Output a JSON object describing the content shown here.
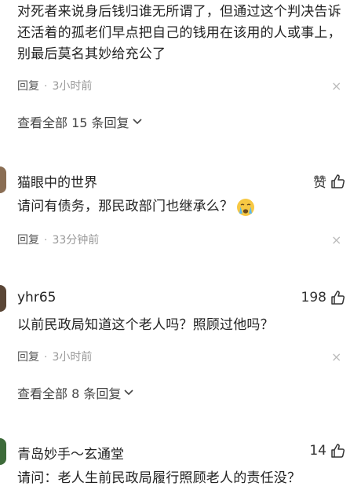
{
  "comments": [
    {
      "text": "对死者来说身后钱归谁无所谓了，但通过这个判决告诉还活着的孤老们早点把自己的钱用在该用的人或事上，别最后莫名其妙给充公了",
      "reply_label": "回复",
      "separator": "·",
      "time": "3小时前",
      "close": "×",
      "view_replies": "查看全部 15 条回复"
    },
    {
      "username": "猫眼中的世界",
      "like_label": "赞",
      "text": "请问有债务，那民政部门也继承么？",
      "emoji": "crying-face-emoji",
      "reply_label": "回复",
      "separator": "·",
      "time": "33分钟前",
      "close": "×"
    },
    {
      "username": "yhr65",
      "like_count": "198",
      "text": "以前民政局知道这个老人吗？照顾过他吗？",
      "reply_label": "回复",
      "separator": "·",
      "time": "3小时前",
      "close": "×",
      "view_replies": "查看全部 8 条回复"
    },
    {
      "username": "青岛妙手～玄通堂",
      "like_count": "14",
      "text": "请问：老人生前民政局履行照顾老人的责任没？"
    }
  ],
  "icons": {
    "thumb": "thumbs-up-icon",
    "chevron": "chevron-down-icon",
    "close": "close-icon"
  },
  "colors": {
    "avatar_1": "#8a6e54",
    "avatar_2": "#5a4636",
    "avatar_3": "#3d6b3a",
    "text": "#222222",
    "meta": "#999999"
  }
}
